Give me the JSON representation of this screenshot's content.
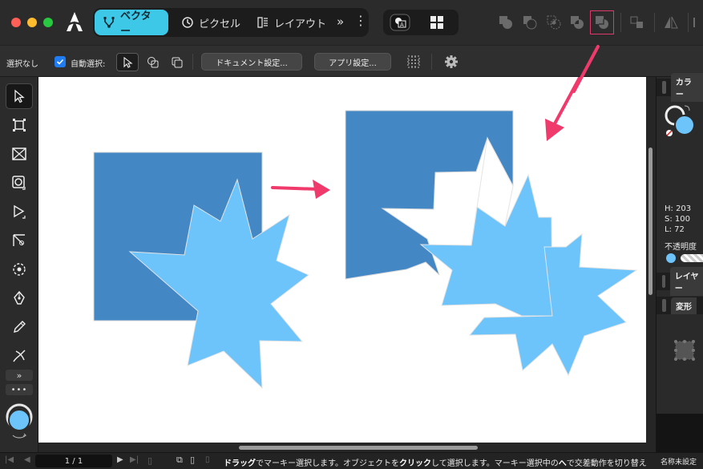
{
  "titlebar": {
    "personas": [
      {
        "label": "ベクター",
        "active": true
      },
      {
        "label": "ピクセル",
        "active": false
      },
      {
        "label": "レイアウト",
        "active": false
      }
    ],
    "more_glyph": "»"
  },
  "contextbar": {
    "selection_status": "選択なし",
    "auto_select_label": "自動選択:",
    "auto_select_checked": true,
    "document_settings_label": "ドキュメント設定...",
    "app_settings_label": "アプリ設定..."
  },
  "right_panel": {
    "color_tab": "カラー",
    "hsl": {
      "h": "H: 203",
      "s": "S: 100",
      "l": "L: 72"
    },
    "opacity_label": "不透明度",
    "layers_tab": "レイヤー",
    "transform_tab": "変形"
  },
  "statusbar": {
    "page_indicator": "1 / 1",
    "hint_drag": "ドラッグ",
    "hint_part1": "でマーキー選択します。オブジェクトを",
    "hint_click": "クリック",
    "hint_part2": "して選択します。マーキー選択中の",
    "hint_key": "へ",
    "hint_part3": "で交差動作を切り替え",
    "document_name": "名称未設定"
  },
  "colors": {
    "accent": "#3dc8e8",
    "square_blue": "#4487c5",
    "star_blue": "#6cc4fb",
    "arrow_pink": "#ef3a6b",
    "highlight_outline": "#e0386a",
    "checkbox_blue": "#1f7cf2"
  },
  "icons": {
    "logo": "designer-logo-icon",
    "vector": "vector-persona-icon",
    "pixel": "pixel-persona-icon",
    "layout": "layout-persona-icon",
    "boolean_ops": [
      "add-icon",
      "subtract-icon",
      "intersect-icon",
      "xor-icon",
      "divide-icon"
    ]
  }
}
